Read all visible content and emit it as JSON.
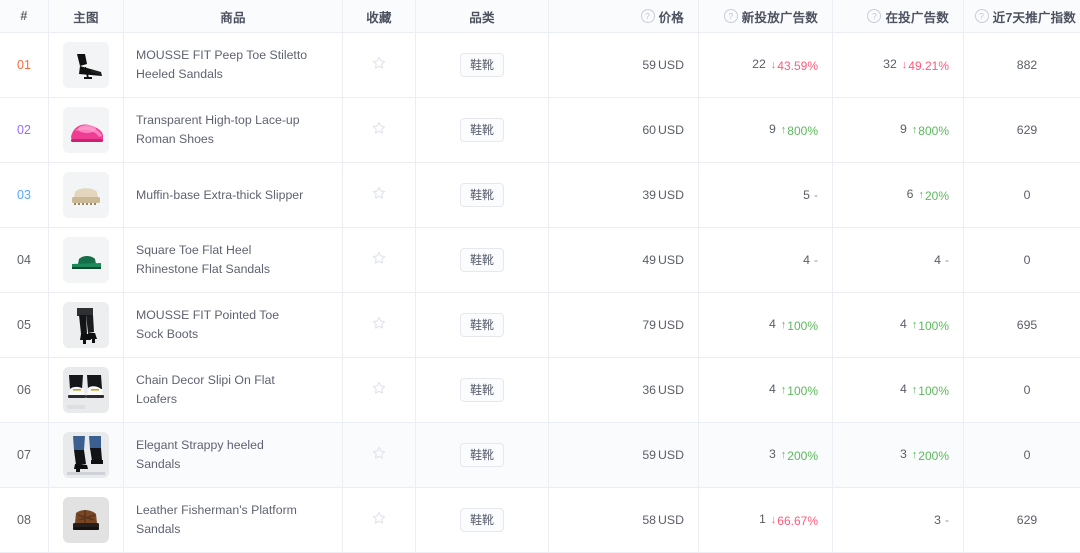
{
  "table": {
    "columns": [
      {
        "key": "rank",
        "label": "#",
        "help": false,
        "align": "center"
      },
      {
        "key": "image",
        "label": "主图",
        "help": false,
        "align": "center"
      },
      {
        "key": "name",
        "label": "商品",
        "help": false,
        "align": "center"
      },
      {
        "key": "favorite",
        "label": "收藏",
        "help": false,
        "align": "center"
      },
      {
        "key": "category",
        "label": "品类",
        "help": false,
        "align": "center"
      },
      {
        "key": "price",
        "label": "价格",
        "help": true,
        "align": "right"
      },
      {
        "key": "new_ads",
        "label": "新投放广告数",
        "help": true,
        "align": "right"
      },
      {
        "key": "running_ads",
        "label": "在投广告数",
        "help": true,
        "align": "right"
      },
      {
        "key": "promo_index",
        "label": "近7天推广指数",
        "help": true,
        "align": "center"
      }
    ],
    "help_icon": "question-circle-icon",
    "favorite_icon": "star-outline-icon",
    "rank_colors": {
      "1": "#fa6a3c",
      "2": "#9b6ef3",
      "3": "#54a8ff",
      "default": "#606266"
    },
    "delta_colors": {
      "up": "#5cb85c",
      "down": "#ff5a7a",
      "flat": "#909399"
    },
    "rows": [
      {
        "rank": "01",
        "rank_style": "rank-1",
        "name_line1": "MOUSSE FIT Peep Toe Stiletto",
        "name_line2": "Heeled Sandals",
        "category": "鞋靴",
        "price": "59",
        "price_unit": "USD",
        "new_ads": "22",
        "new_ads_delta": "43.59%",
        "new_ads_dir": "down",
        "running_ads": "32",
        "running_ads_delta": "49.21%",
        "running_ads_dir": "down",
        "promo_index": "882",
        "image": "black-stiletto-heeled-sandal",
        "highlight": false
      },
      {
        "rank": "02",
        "rank_style": "rank-2",
        "name_line1": "Transparent High-top Lace-up",
        "name_line2": "Roman Shoes",
        "category": "鞋靴",
        "price": "60",
        "price_unit": "USD",
        "new_ads": "9",
        "new_ads_delta": "800%",
        "new_ads_dir": "up",
        "running_ads": "9",
        "running_ads_delta": "800%",
        "running_ads_dir": "up",
        "promo_index": "629",
        "image": "pink-transparent-roman-shoe",
        "highlight": false
      },
      {
        "rank": "03",
        "rank_style": "rank-3",
        "name_line1": "Muffin-base Extra-thick Slipper",
        "name_line2": "",
        "category": "鞋靴",
        "price": "39",
        "price_unit": "USD",
        "new_ads": "5",
        "new_ads_delta": "-",
        "new_ads_dir": "flat",
        "running_ads": "6",
        "running_ads_delta": "20%",
        "running_ads_dir": "up",
        "promo_index": "0",
        "image": "beige-muffin-platform-slipper",
        "highlight": false
      },
      {
        "rank": "04",
        "rank_style": "",
        "name_line1": "Square Toe Flat Heel",
        "name_line2": "Rhinestone Flat Sandals",
        "category": "鞋靴",
        "price": "49",
        "price_unit": "USD",
        "new_ads": "4",
        "new_ads_delta": "-",
        "new_ads_dir": "flat",
        "running_ads": "4",
        "running_ads_delta": "-",
        "running_ads_dir": "flat",
        "promo_index": "0",
        "image": "green-flat-slide-sandal",
        "highlight": false
      },
      {
        "rank": "05",
        "rank_style": "",
        "name_line1": "MOUSSE FIT Pointed Toe",
        "name_line2": "Sock Boots",
        "category": "鞋靴",
        "price": "79",
        "price_unit": "USD",
        "new_ads": "4",
        "new_ads_delta": "100%",
        "new_ads_dir": "up",
        "running_ads": "4",
        "running_ads_delta": "100%",
        "running_ads_dir": "up",
        "promo_index": "695",
        "image": "black-knee-high-sock-boot",
        "highlight": false
      },
      {
        "rank": "06",
        "rank_style": "",
        "name_line1": "Chain Decor Slipi On Flat",
        "name_line2": "Loafers",
        "category": "鞋靴",
        "price": "36",
        "price_unit": "USD",
        "new_ads": "4",
        "new_ads_delta": "100%",
        "new_ads_dir": "up",
        "running_ads": "4",
        "running_ads_delta": "100%",
        "running_ads_dir": "up",
        "promo_index": "0",
        "image": "white-chain-loafer",
        "highlight": false
      },
      {
        "rank": "07",
        "rank_style": "",
        "name_line1": "Elegant Strappy heeled",
        "name_line2": "Sandals",
        "category": "鞋靴",
        "price": "59",
        "price_unit": "USD",
        "new_ads": "3",
        "new_ads_delta": "200%",
        "new_ads_dir": "up",
        "running_ads": "3",
        "running_ads_delta": "200%",
        "running_ads_dir": "up",
        "promo_index": "0",
        "image": "black-strappy-heeled-sandal",
        "highlight": true
      },
      {
        "rank": "08",
        "rank_style": "",
        "name_line1": "Leather Fisherman's Platform",
        "name_line2": "Sandals",
        "category": "鞋靴",
        "price": "58",
        "price_unit": "USD",
        "new_ads": "1",
        "new_ads_delta": "66.67%",
        "new_ads_dir": "down",
        "running_ads": "3",
        "running_ads_delta": "-",
        "running_ads_dir": "flat",
        "promo_index": "629",
        "image": "brown-fisherman-platform-sandal",
        "highlight": false
      }
    ]
  }
}
